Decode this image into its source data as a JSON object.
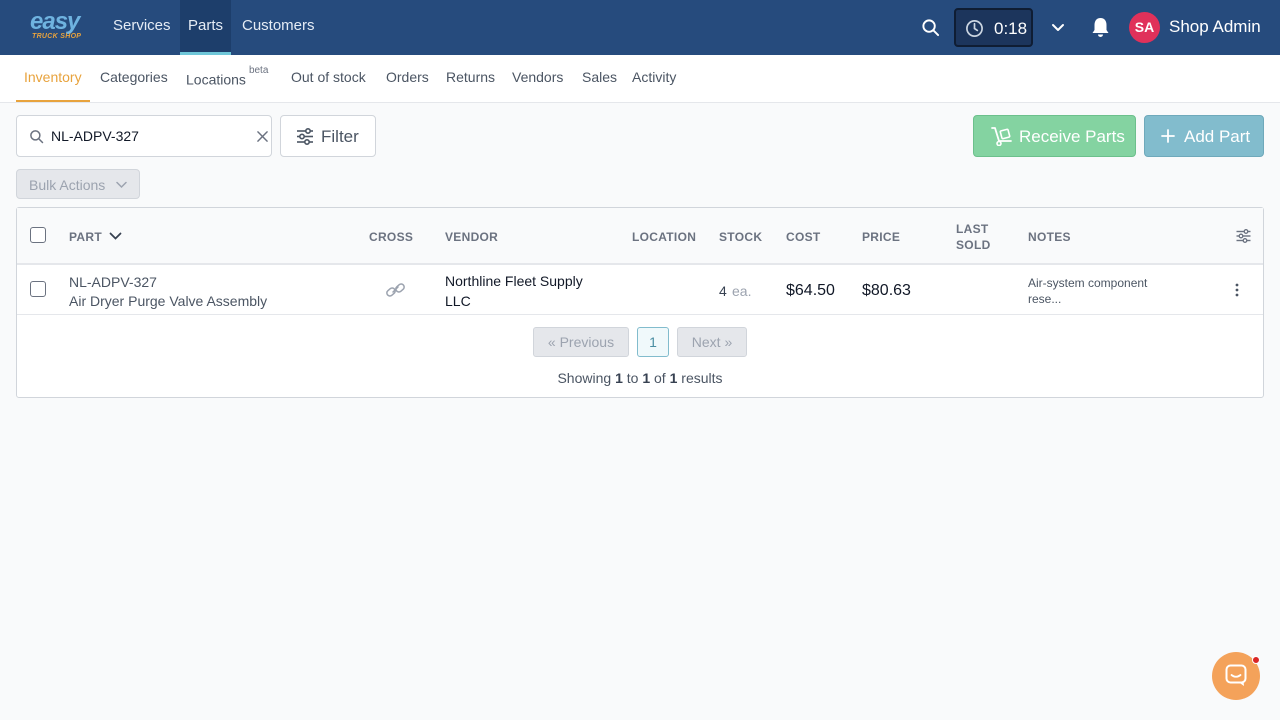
{
  "app": {
    "logo_text": "easy",
    "logo_subtext": "TRUCK SHOP",
    "nav": [
      {
        "label": "Services"
      },
      {
        "label": "Parts"
      },
      {
        "label": "Customers"
      }
    ],
    "active_nav": "Parts",
    "timer": "0:18",
    "user": {
      "initials": "SA",
      "name": "Shop Admin"
    },
    "colors": {
      "header": "#264b7d",
      "accent": "#e8a33d",
      "receive": "#84d3a1",
      "add": "#82bccd",
      "avatar": "#e0315a"
    }
  },
  "subnav": {
    "tabs": [
      {
        "label": "Inventory"
      },
      {
        "label": "Categories"
      },
      {
        "label": "Locations",
        "badge": "beta"
      },
      {
        "label": "Out of stock"
      },
      {
        "label": "Orders"
      },
      {
        "label": "Returns"
      },
      {
        "label": "Vendors"
      },
      {
        "label": "Sales"
      },
      {
        "label": "Activity"
      }
    ],
    "active": "Inventory"
  },
  "toolbar": {
    "search_value": "NL-ADPV-327",
    "filter_label": "Filter",
    "receive_label": "Receive Parts",
    "add_label": "Add Part",
    "bulk_label": "Bulk Actions"
  },
  "table": {
    "columns": {
      "part": "PART",
      "cross": "CROSS",
      "vendor": "VENDOR",
      "location": "LOCATION",
      "stock": "STOCK",
      "cost": "COST",
      "price": "PRICE",
      "last_sold_1": "LAST",
      "last_sold_2": "SOLD",
      "notes": "NOTES"
    },
    "rows": [
      {
        "part_number": "NL-ADPV-327",
        "part_name": "Air Dryer Purge Valve Assembly",
        "vendor_line1": "Northline Fleet Supply",
        "vendor_line2": "LLC",
        "location": "",
        "stock_qty": "4",
        "stock_unit": "ea.",
        "cost": "$64.50",
        "price": "$80.63",
        "last_sold": "",
        "notes_line1": "Air-system component",
        "notes_line2": "rese..."
      }
    ]
  },
  "pagination": {
    "previous": "« Previous",
    "current": "1",
    "next": "Next »",
    "showing_prefix": "Showing",
    "from": "1",
    "to_word": "to",
    "to": "1",
    "of_word": "of",
    "total": "1",
    "results_word": "results"
  }
}
